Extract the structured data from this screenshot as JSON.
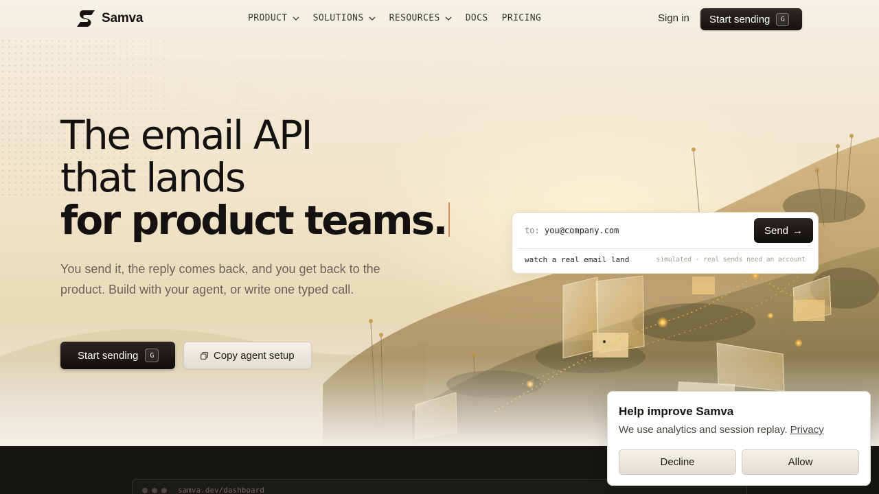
{
  "brand": {
    "name": "Samva",
    "logo_icon": "samva-s-logo-icon"
  },
  "nav": {
    "items": [
      {
        "label": "PRODUCT",
        "has_dropdown": true
      },
      {
        "label": "SOLUTIONS",
        "has_dropdown": true
      },
      {
        "label": "RESOURCES",
        "has_dropdown": true
      },
      {
        "label": "DOCS",
        "has_dropdown": false
      },
      {
        "label": "PRICING",
        "has_dropdown": false
      }
    ],
    "sign_in": "Sign in",
    "cta_label": "Start sending",
    "cta_shortcut": "G"
  },
  "hero": {
    "line1": "The email API",
    "line2": "that lands",
    "line3": "for product teams.",
    "subtitle": "You send it, the reply comes back, and you get back to the product. Build with your agent, or write one typed call.",
    "primary_cta": "Start sending",
    "primary_shortcut": "G",
    "secondary_cta": "Copy agent setup",
    "secondary_icon": "copy-icon"
  },
  "send_card": {
    "to_label": "to:",
    "email_value": "you@company.com",
    "send_label": "Send",
    "send_arrow": "→",
    "hint": "watch a real email land",
    "note": "simulated · real sends need an account"
  },
  "dashboard": {
    "url": "samva.dev/dashboard"
  },
  "consent": {
    "title": "Help improve Samva",
    "text": "We use analytics and session replay.",
    "privacy_link": "Privacy",
    "decline": "Decline",
    "allow": "Allow"
  },
  "colors": {
    "ink": "#141210",
    "accent_caret": "#d98a60",
    "dark_panel": "#171511",
    "glow": "#f5b54a"
  }
}
